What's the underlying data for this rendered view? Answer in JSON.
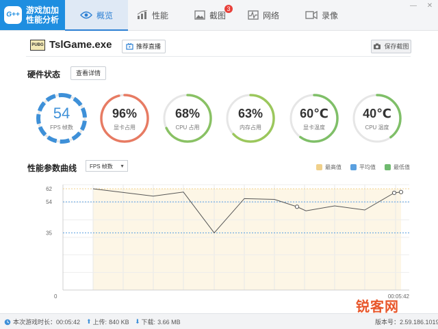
{
  "brand": {
    "logo": "G++",
    "line1": "游戏加加",
    "line2": "性能分析"
  },
  "tabs": [
    {
      "label": "概览",
      "icon": "eye-icon"
    },
    {
      "label": "性能",
      "icon": "bar-chart-icon"
    },
    {
      "label": "截图",
      "icon": "image-icon",
      "badge": "3"
    },
    {
      "label": "网络",
      "icon": "pulse-icon"
    },
    {
      "label": "录像",
      "icon": "video-icon"
    }
  ],
  "game": {
    "badge": "PUBG",
    "name": "TslGame.exe",
    "recommend_label": "推荐直播",
    "save_label": "保存截图"
  },
  "hardware": {
    "title": "硬件状态",
    "details_label": "查看详情",
    "gauges": [
      {
        "value": "54",
        "label": "FPS 帧数",
        "level": 1.0,
        "color": "#3e90d8",
        "style": "dashed"
      },
      {
        "value": "96%",
        "label": "显卡占用",
        "level": 0.96,
        "color": "#e77b63",
        "style": "solid"
      },
      {
        "value": "68%",
        "label": "CPU 占用",
        "level": 0.68,
        "color": "#89c164",
        "style": "solid"
      },
      {
        "value": "63%",
        "label": "内存占用",
        "level": 0.63,
        "color": "#9bc75c",
        "style": "solid"
      },
      {
        "value": "60℃",
        "label": "显卡温度",
        "level": 0.6,
        "color": "#7fbf68",
        "style": "solid"
      },
      {
        "value": "40℃",
        "label": "CPU 温度",
        "level": 0.4,
        "color": "#7fbf68",
        "style": "solid"
      }
    ]
  },
  "perf": {
    "title": "性能参数曲线",
    "select_value": "FPS 帧数",
    "legend": [
      {
        "label": "最高值",
        "color": "#f0d08a"
      },
      {
        "label": "平均值",
        "color": "#5aa0e0"
      },
      {
        "label": "最低值",
        "color": "#6fba6f"
      }
    ]
  },
  "chart_data": {
    "type": "line",
    "y_ticks": [
      "62",
      "54",
      "35"
    ],
    "y_min_label": "0",
    "x_end_label": "00:05:42",
    "ylim": [
      0,
      62
    ],
    "max_line": 62,
    "avg_line": 54,
    "min_line": 35,
    "values": [
      62,
      57.5,
      60,
      35,
      56,
      55.5,
      51,
      48.5,
      51.5,
      49,
      59.5,
      60
    ]
  },
  "status": {
    "play_time_label": "本次游戏时长：",
    "play_time": "00:05:42",
    "upload_label": "上传:",
    "upload": "840 KB",
    "download_label": "下载:",
    "download": "3.66 MB",
    "version_label": "版本号：",
    "version": "2.59.186.1019"
  },
  "watermark": "锐客网"
}
